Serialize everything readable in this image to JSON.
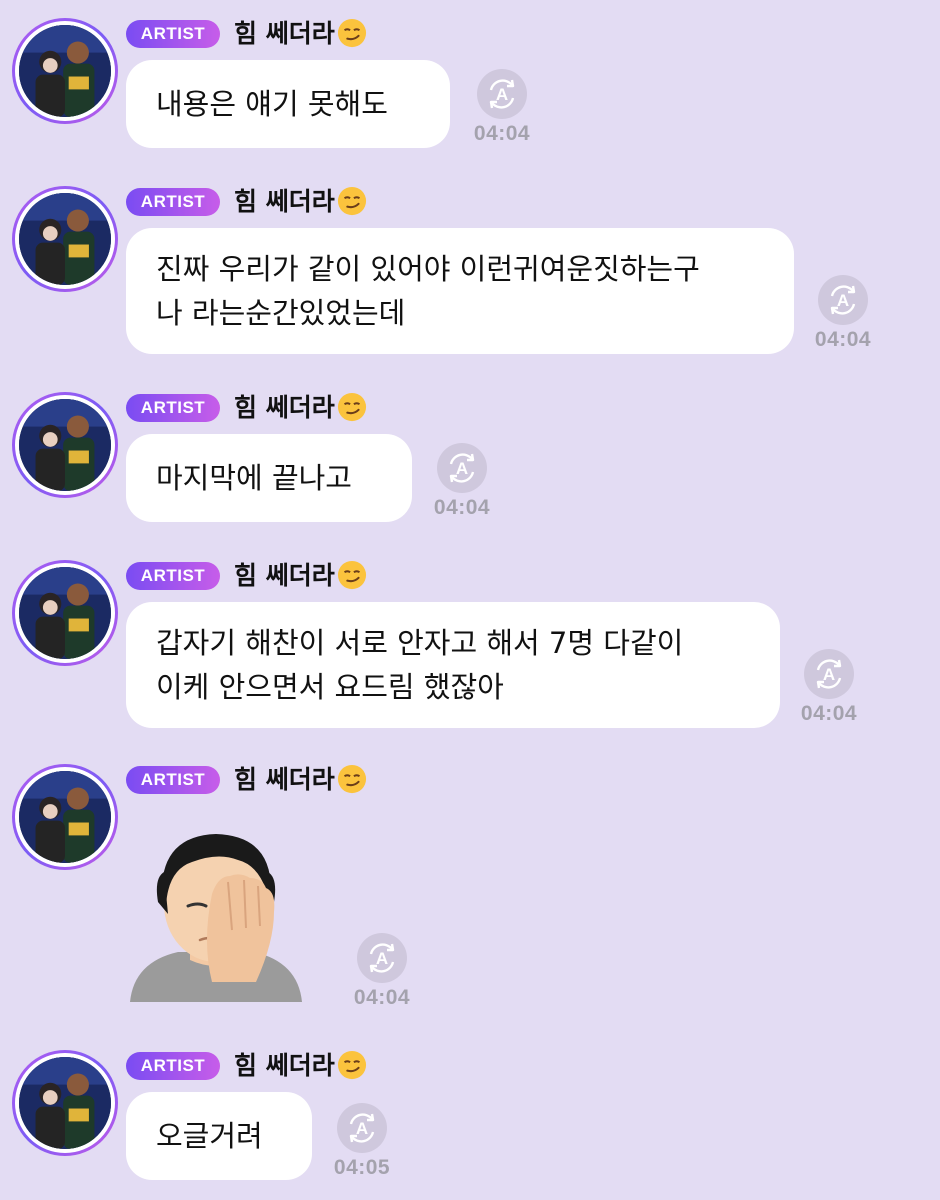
{
  "sender": {
    "badge": "ARTIST",
    "name": "힘 쎄더라"
  },
  "messages": [
    {
      "type": "text",
      "lines": [
        "내용은 얘기 못해도"
      ],
      "time": "04:04"
    },
    {
      "type": "text",
      "lines": [
        "진짜 우리가 같이 있어야 이런귀여운짓하는구",
        "나 라는순간있었는데"
      ],
      "time": "04:04"
    },
    {
      "type": "text",
      "lines": [
        "마지막에 끝나고"
      ],
      "time": "04:04"
    },
    {
      "type": "text",
      "lines": [
        "갑자기 해찬이 서로 안자고 해서 7명 다같이",
        "이케 안으면서 요드림 했잖아"
      ],
      "time": "04:04"
    },
    {
      "type": "sticker",
      "sticker": "face-palm-emoji",
      "time": "04:04"
    },
    {
      "type": "text",
      "lines": [
        "오글거려"
      ],
      "time": "04:05"
    }
  ],
  "icons": {
    "translate": "translate-icon",
    "name_emoji": "smirking-face-emoji"
  },
  "colors": {
    "background": "#e3dcf3",
    "badge_start": "#7a4cf2",
    "badge_end": "#c75de9",
    "timestamp": "#a4a2ad"
  }
}
